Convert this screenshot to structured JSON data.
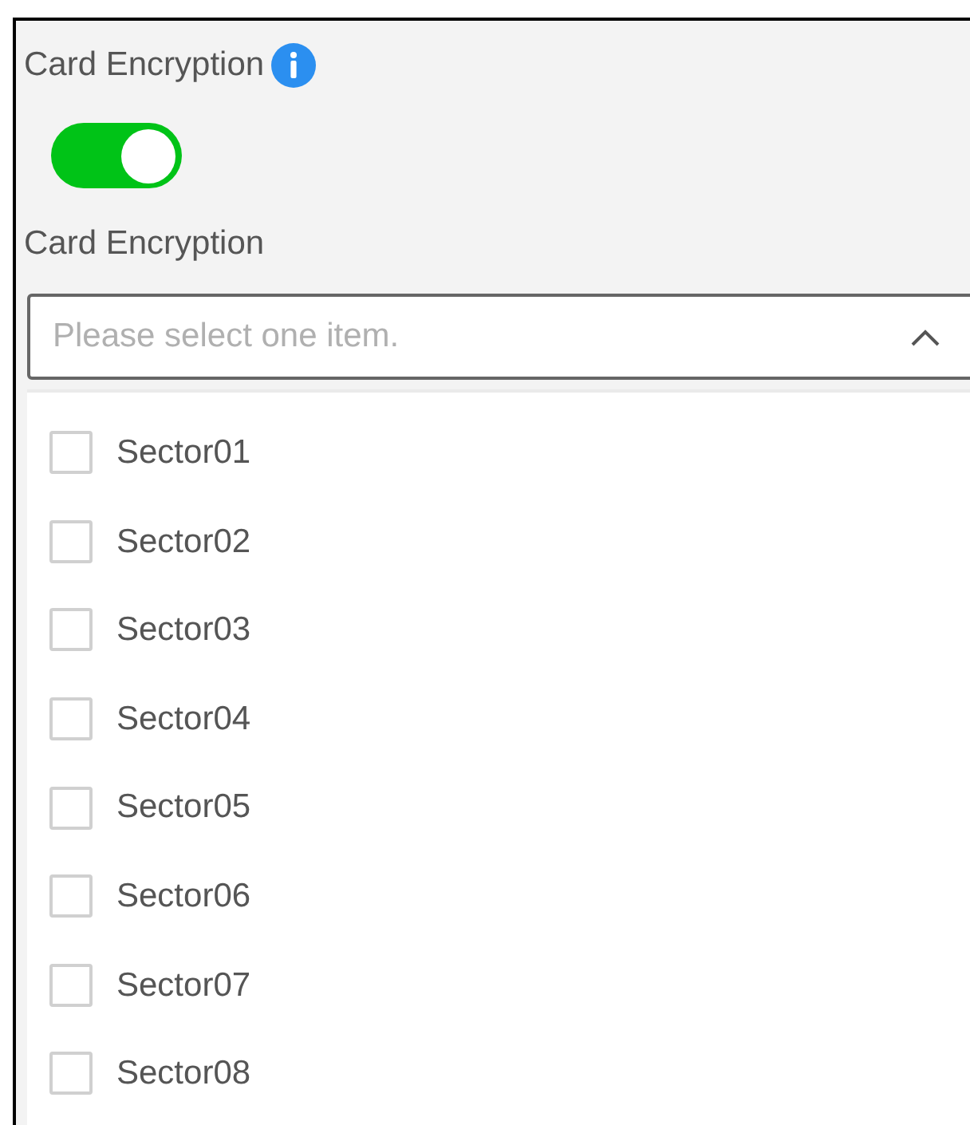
{
  "label": "Card Encryption",
  "toggle": {
    "on": true
  },
  "select": {
    "label": "Card Encryption",
    "placeholder": "Please select one item.",
    "expanded": true
  },
  "options": [
    {
      "label": "Sector01",
      "checked": false
    },
    {
      "label": "Sector02",
      "checked": false
    },
    {
      "label": "Sector03",
      "checked": false
    },
    {
      "label": "Sector04",
      "checked": false
    },
    {
      "label": "Sector05",
      "checked": false
    },
    {
      "label": "Sector06",
      "checked": false
    },
    {
      "label": "Sector07",
      "checked": false
    },
    {
      "label": "Sector08",
      "checked": false
    }
  ]
}
